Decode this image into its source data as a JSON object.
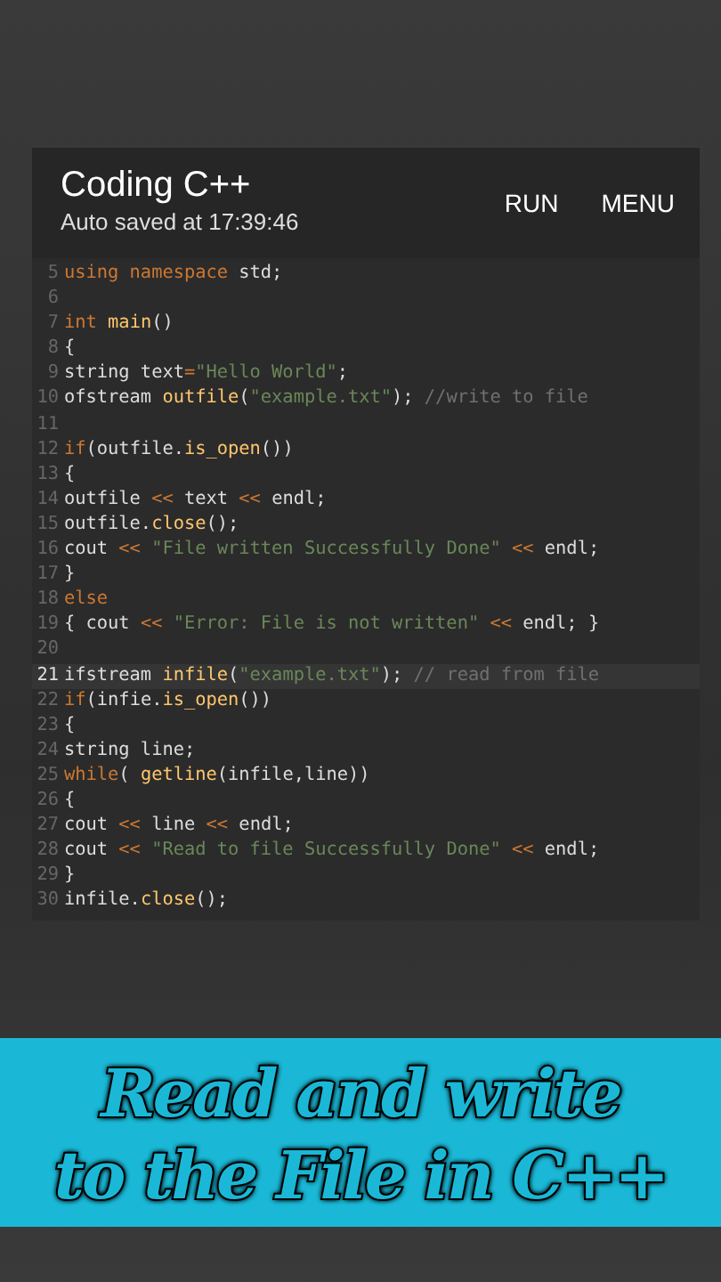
{
  "app_bar": {
    "title": "Coding C++",
    "subtitle": "Auto saved at 17:39:46",
    "actions": [
      "RUN",
      "MENU"
    ]
  },
  "editor": {
    "lines": [
      {
        "number": "5",
        "selected": false,
        "tokens": [
          {
            "kind": "kw",
            "text": "using namespace "
          },
          {
            "kind": "plain",
            "text": "std;"
          }
        ]
      },
      {
        "number": "6",
        "selected": false
      },
      {
        "number": "7",
        "selected": false,
        "tokens": [
          {
            "kind": "kw",
            "text": "int "
          },
          {
            "kind": "fn",
            "text": "main"
          },
          {
            "kind": "plain",
            "text": "()"
          }
        ]
      },
      {
        "number": "8",
        "selected": false,
        "tokens": [
          {
            "kind": "plain",
            "text": "{"
          }
        ]
      },
      {
        "number": "9",
        "selected": false,
        "tokens": [
          {
            "kind": "plain",
            "text": "string text"
          },
          {
            "kind": "op",
            "text": "="
          },
          {
            "kind": "str",
            "text": "\"Hello World\""
          },
          {
            "kind": "plain",
            "text": ";"
          }
        ]
      },
      {
        "number": "10",
        "selected": false,
        "tokens": [
          {
            "kind": "plain",
            "text": "ofstream "
          },
          {
            "kind": "fn",
            "text": "outfile"
          },
          {
            "kind": "plain",
            "text": "("
          },
          {
            "kind": "str",
            "text": "\"example.txt\""
          },
          {
            "kind": "plain",
            "text": "); "
          },
          {
            "kind": "cm",
            "text": "//write to file"
          }
        ]
      },
      {
        "number": "11",
        "selected": false
      },
      {
        "number": "12",
        "selected": false,
        "tokens": [
          {
            "kind": "kw",
            "text": "if"
          },
          {
            "kind": "plain",
            "text": "(outfile."
          },
          {
            "kind": "fn",
            "text": "is_open"
          },
          {
            "kind": "plain",
            "text": "())"
          }
        ]
      },
      {
        "number": "13",
        "selected": false,
        "tokens": [
          {
            "kind": "plain",
            "text": "{"
          }
        ]
      },
      {
        "number": "14",
        "selected": false,
        "tokens": [
          {
            "kind": "plain",
            "text": "outfile "
          },
          {
            "kind": "op",
            "text": "<<"
          },
          {
            "kind": "plain",
            "text": " text "
          },
          {
            "kind": "op",
            "text": "<<"
          },
          {
            "kind": "plain",
            "text": " endl;"
          }
        ]
      },
      {
        "number": "15",
        "selected": false,
        "tokens": [
          {
            "kind": "plain",
            "text": "outfile."
          },
          {
            "kind": "fn",
            "text": "close"
          },
          {
            "kind": "plain",
            "text": "();"
          }
        ]
      },
      {
        "number": "16",
        "selected": false,
        "tokens": [
          {
            "kind": "plain",
            "text": "cout "
          },
          {
            "kind": "op",
            "text": "<<"
          },
          {
            "kind": "str",
            "text": " \"File written Successfully Done\" "
          },
          {
            "kind": "op",
            "text": "<<"
          },
          {
            "kind": "plain",
            "text": " endl;"
          }
        ]
      },
      {
        "number": "17",
        "selected": false,
        "tokens": [
          {
            "kind": "plain",
            "text": "}"
          }
        ]
      },
      {
        "number": "18",
        "selected": false,
        "tokens": [
          {
            "kind": "kw",
            "text": "else"
          }
        ]
      },
      {
        "number": "19",
        "selected": false,
        "tokens": [
          {
            "kind": "plain",
            "text": "{ cout "
          },
          {
            "kind": "op",
            "text": "<<"
          },
          {
            "kind": "str",
            "text": " \"Error: File is not written\" "
          },
          {
            "kind": "op",
            "text": "<<"
          },
          {
            "kind": "plain",
            "text": " endl; }"
          }
        ]
      },
      {
        "number": "20",
        "selected": false
      },
      {
        "number": "21",
        "selected": true,
        "tokens": [
          {
            "kind": "plain",
            "text": "ifstream "
          },
          {
            "kind": "fn",
            "text": "infile"
          },
          {
            "kind": "plain",
            "text": "("
          },
          {
            "kind": "str",
            "text": "\"example.txt\""
          },
          {
            "kind": "plain",
            "text": "); "
          },
          {
            "kind": "cm",
            "text": "// read from file"
          }
        ]
      },
      {
        "number": "22",
        "selected": false,
        "tokens": [
          {
            "kind": "kw",
            "text": "if"
          },
          {
            "kind": "plain",
            "text": "(infie."
          },
          {
            "kind": "fn",
            "text": "is_open"
          },
          {
            "kind": "plain",
            "text": "())"
          }
        ]
      },
      {
        "number": "23",
        "selected": false,
        "tokens": [
          {
            "kind": "plain",
            "text": "{"
          }
        ]
      },
      {
        "number": "24",
        "selected": false,
        "tokens": [
          {
            "kind": "plain",
            "text": "string line;"
          }
        ]
      },
      {
        "number": "25",
        "selected": false,
        "tokens": [
          {
            "kind": "kw",
            "text": "while"
          },
          {
            "kind": "plain",
            "text": "( "
          },
          {
            "kind": "fn",
            "text": "getline"
          },
          {
            "kind": "plain",
            "text": "(infile,line))"
          }
        ]
      },
      {
        "number": "26",
        "selected": false,
        "tokens": [
          {
            "kind": "plain",
            "text": "{"
          }
        ]
      },
      {
        "number": "27",
        "selected": false,
        "tokens": [
          {
            "kind": "plain",
            "text": "cout "
          },
          {
            "kind": "op",
            "text": "<<"
          },
          {
            "kind": "plain",
            "text": " line "
          },
          {
            "kind": "op",
            "text": "<<"
          },
          {
            "kind": "plain",
            "text": " endl;"
          }
        ]
      },
      {
        "number": "28",
        "selected": false,
        "tokens": [
          {
            "kind": "plain",
            "text": "cout "
          },
          {
            "kind": "op",
            "text": "<<"
          },
          {
            "kind": "str",
            "text": " \"Read to file Successfully Done\" "
          },
          {
            "kind": "op",
            "text": "<<"
          },
          {
            "kind": "plain",
            "text": " endl;"
          }
        ]
      },
      {
        "number": "29",
        "selected": false,
        "tokens": [
          {
            "kind": "plain",
            "text": "}"
          }
        ]
      },
      {
        "number": "30",
        "selected": false,
        "tokens": [
          {
            "kind": "plain",
            "text": "infile."
          },
          {
            "kind": "fn",
            "text": "close"
          },
          {
            "kind": "plain",
            "text": "();"
          }
        ]
      }
    ]
  },
  "caption": [
    "Read and write",
    "to the File in C++"
  ]
}
